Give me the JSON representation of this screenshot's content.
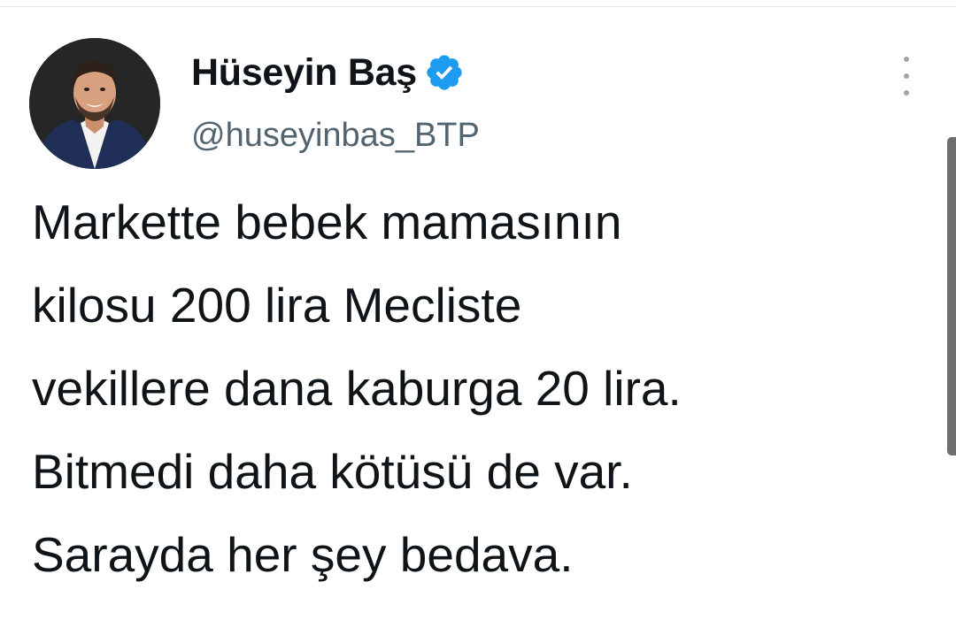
{
  "author": {
    "display_name": "Hüseyin Baş",
    "handle": "@huseyinbas_BTP",
    "verified": true,
    "verified_icon": "verified-badge-icon",
    "avatar_icon": "profile-photo"
  },
  "actions": {
    "more_icon": "more-vertical-icon"
  },
  "tweet": {
    "lines": [
      "Markette bebek mamasının",
      "kilosu 200 lira Mecliste",
      "vekillere dana kaburga 20 lira.",
      "Bitmedi daha kötüsü de var.",
      "Sarayda her şey bedava."
    ]
  },
  "colors": {
    "text_primary": "#0f1419",
    "text_secondary": "#536471",
    "verified_blue": "#1d9bf0",
    "background": "#ffffff"
  }
}
